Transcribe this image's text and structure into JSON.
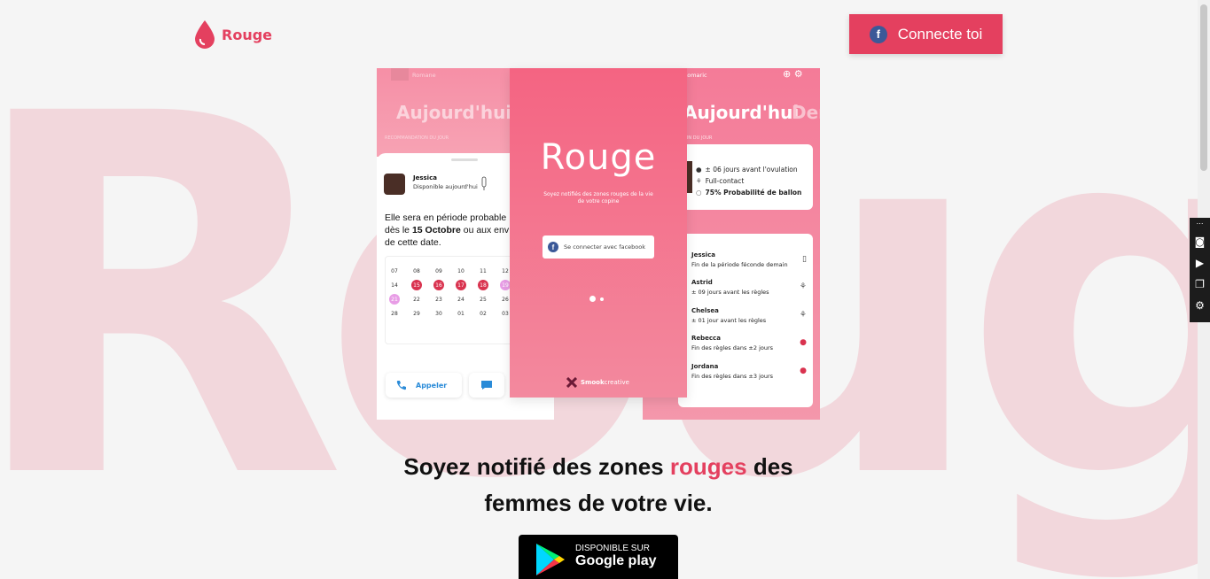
{
  "background_word": "Rouge",
  "header": {
    "logo_text": "Rouge",
    "connect_label": "Connecte toi",
    "fb_letter": "f"
  },
  "phone_left": {
    "top_name": "Romane",
    "today_label": "Aujourd'hui",
    "section_label": "RECOMMANDATION DU JOUR",
    "contact_name": "Jessica",
    "contact_status": "Disponible aujourd'hui",
    "message_part1": "Elle sera en période probable",
    "message_part2": "dès le",
    "message_date": "15 Octobre",
    "message_part3": "ou aux env",
    "message_part4": "de cette date.",
    "calendar_days": [
      "07",
      "08",
      "09",
      "10",
      "11",
      "12",
      "14",
      "15",
      "16",
      "17",
      "18",
      "19",
      "21",
      "22",
      "23",
      "24",
      "25",
      "26",
      "28",
      "29",
      "30",
      "01",
      "02",
      "03"
    ],
    "call_label": "Appeler"
  },
  "phone_mid": {
    "logo": "Rouge",
    "subtitle": "Soyez notifiés des zones rouges de la vie de votre copine",
    "fb_button": "Se connecter avec facebook",
    "credit_bold": "Smook",
    "credit_rest": "creative"
  },
  "phone_right": {
    "top_name": "Romaric",
    "today_label": "Aujourd'hui",
    "next_label": "Dem",
    "section_label": "ION DU JOUR",
    "card_lines": [
      "± 06 jours avant l'ovulation",
      "Full-contact",
      "75% Probabilité de ballon"
    ],
    "items": [
      {
        "name": "Jessica",
        "detail": "Fin de la période féconde demain"
      },
      {
        "name": "Astrid",
        "detail": "± 09 jours avant les règles"
      },
      {
        "name": "Chelsea",
        "detail": "± 01 jour avant les règles"
      },
      {
        "name": "Rebecca",
        "detail": "Fin des règles dans ±2 jours"
      },
      {
        "name": "Jordana",
        "detail": "Fin des règles dans ±3 jours"
      }
    ]
  },
  "headline": {
    "part1": "Soyez notifié des zones",
    "accent": "rouges",
    "part2": "des",
    "line2": "femmes de votre vie."
  },
  "store": {
    "top": "DISPONIBLE SUR",
    "main": "Google play"
  },
  "colors": {
    "accent": "#e4405f",
    "background_word": "#f2d7dc"
  }
}
